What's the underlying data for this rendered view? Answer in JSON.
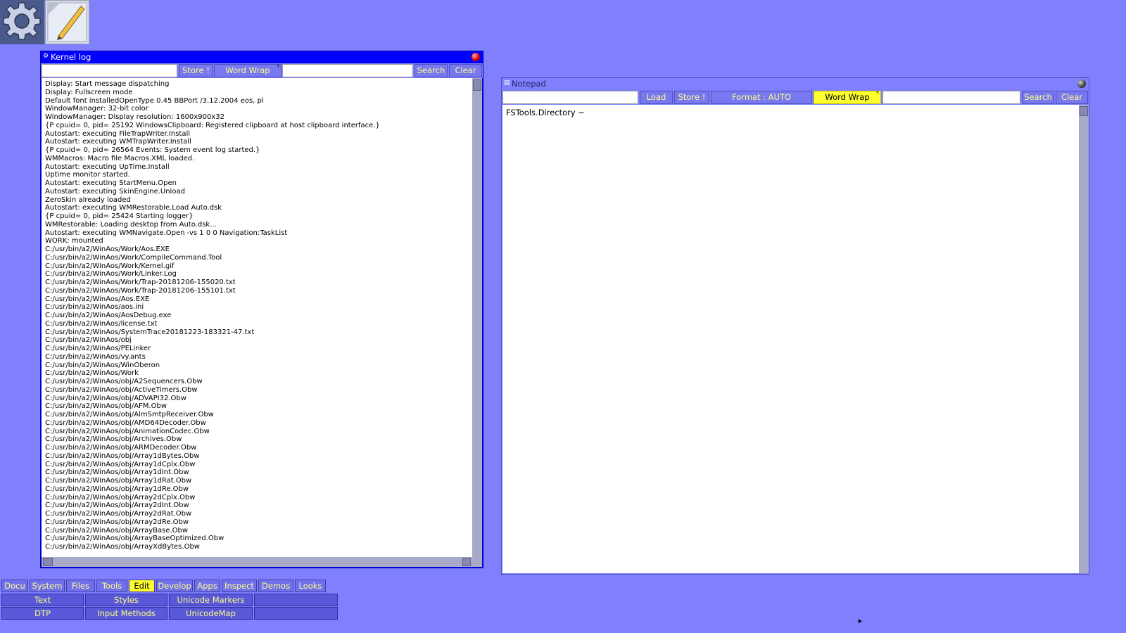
{
  "desktop": {
    "icons": [
      {
        "name": "gear-icon"
      },
      {
        "name": "notepad-pencil-icon"
      }
    ]
  },
  "kernel_log": {
    "title": "Kernel log",
    "search_value": "",
    "buttons": {
      "store": "Store !",
      "word_wrap": "Word Wrap",
      "search": "Search",
      "clear": "Clear"
    },
    "lines": [
      "Display: Start message dispatching",
      "Display: Fullscreen mode",
      "Default font installedOpenType 0.45 BBPort /3.12.2004  eos, pl",
      "WindowManager: 32-bit color",
      "WindowManager: Display resolution: 1600x900x32",
      "{P cpuid= 0, pid= 25192 WindowsClipboard: Registered clipboard at host clipboard interface.}",
      "Autostart: executing FileTrapWriter.Install",
      "Autostart: executing WMTrapWriter.Install",
      "{P cpuid= 0, pid= 26564 Events: System event log started.}",
      "WMMacros: Macro file Macros.XML loaded.",
      "Autostart: executing UpTime.Install",
      "Uptime monitor started.",
      "Autostart: executing StartMenu.Open",
      "Autostart: executing SkinEngine.Unload",
      "ZeroSkin already loaded",
      "Autostart: executing WMRestorable.Load Auto.dsk",
      "{P cpuid= 0, pid= 25424 Starting logger}",
      "WMRestorable: Loading desktop from Auto.dsk...",
      "Autostart: executing WMNavigate.Open -vs 1 0 0 Navigation:TaskList",
      "WORK: mounted",
      "C:/usr/bin/a2/WinAos/Work/Aos.EXE",
      "C:/usr/bin/a2/WinAos/Work/CompileCommand.Tool",
      "C:/usr/bin/a2/WinAos/Work/Kernel.gif",
      "C:/usr/bin/a2/WinAos/Work/Linker.Log",
      "C:/usr/bin/a2/WinAos/Work/Trap-20181206-155020.txt",
      "C:/usr/bin/a2/WinAos/Work/Trap-20181206-155101.txt",
      "C:/usr/bin/a2/WinAos/Aos.EXE",
      "C:/usr/bin/a2/WinAos/aos.ini",
      "C:/usr/bin/a2/WinAos/AosDebug.exe",
      "C:/usr/bin/a2/WinAos/license.txt",
      "C:/usr/bin/a2/WinAos/SystemTrace20181223-183321-47.txt",
      "C:/usr/bin/a2/WinAos/obj",
      "C:/usr/bin/a2/WinAos/PELinker",
      "C:/usr/bin/a2/WinAos/vy.ants",
      "C:/usr/bin/a2/WinAos/WinOberon",
      "C:/usr/bin/a2/WinAos/Work",
      "C:/usr/bin/a2/WinAos/obj/A2Sequencers.Obw",
      "C:/usr/bin/a2/WinAos/obj/ActiveTimers.Obw",
      "C:/usr/bin/a2/WinAos/obj/ADVAPI32.Obw",
      "C:/usr/bin/a2/WinAos/obj/AFM.Obw",
      "C:/usr/bin/a2/WinAos/obj/AlmSmtpReceiver.Obw",
      "C:/usr/bin/a2/WinAos/obj/AMD64Decoder.Obw",
      "C:/usr/bin/a2/WinAos/obj/AnimationCodec.Obw",
      "C:/usr/bin/a2/WinAos/obj/Archives.Obw",
      "C:/usr/bin/a2/WinAos/obj/ARMDecoder.Obw",
      "C:/usr/bin/a2/WinAos/obj/Array1dBytes.Obw",
      "C:/usr/bin/a2/WinAos/obj/Array1dCplx.Obw",
      "C:/usr/bin/a2/WinAos/obj/Array1dInt.Obw",
      "C:/usr/bin/a2/WinAos/obj/Array1dRat.Obw",
      "C:/usr/bin/a2/WinAos/obj/Array1dRe.Obw",
      "C:/usr/bin/a2/WinAos/obj/Array2dCplx.Obw",
      "C:/usr/bin/a2/WinAos/obj/Array2dInt.Obw",
      "C:/usr/bin/a2/WinAos/obj/Array2dRat.Obw",
      "C:/usr/bin/a2/WinAos/obj/Array2dRe.Obw",
      "C:/usr/bin/a2/WinAos/obj/ArrayBase.Obw",
      "C:/usr/bin/a2/WinAos/obj/ArrayBaseOptimized.Obw",
      "C:/usr/bin/a2/WinAos/obj/ArrayXdBytes.Obw"
    ]
  },
  "notepad": {
    "title": "Notepad",
    "filename_value": "",
    "buttons": {
      "load": "Load",
      "store": "Store !",
      "format": "Format : AUTO",
      "word_wrap": "Word Wrap",
      "search": "Search",
      "clear": "Clear"
    },
    "search_value": "",
    "text": "FSTools.Directory ~"
  },
  "start_menu": {
    "tabs": [
      "Docu",
      "System",
      "Files",
      "Tools",
      "Edit",
      "Develop",
      "Apps",
      "Inspect",
      "Demos",
      "Looks"
    ],
    "active_tab": "Edit",
    "submenu_row1": [
      "Text",
      "Styles",
      "Unicode Markers",
      ""
    ],
    "submenu_row2": [
      "DTP",
      "Input Methods",
      "UnicodeMap",
      ""
    ]
  },
  "colors": {
    "desktop": "#8080ff",
    "kernel_titlebar": "#0000ff",
    "notepad_titlebar": "#8080ff",
    "button_text": "#ffff80",
    "active_yellow": "#ffff30"
  }
}
